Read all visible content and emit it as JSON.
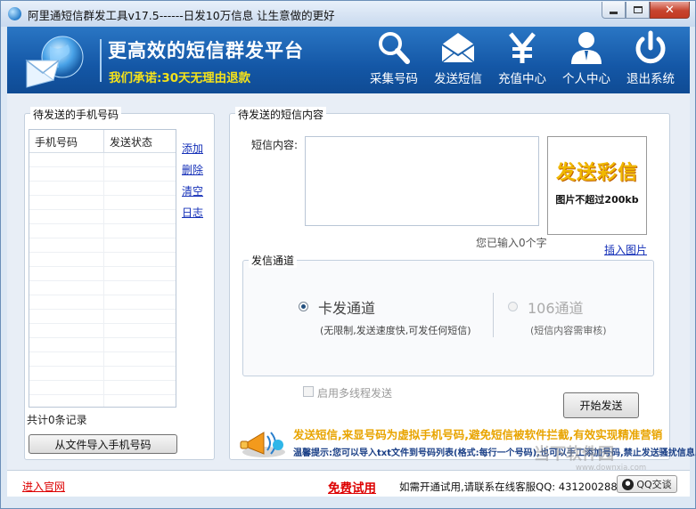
{
  "window": {
    "title": "阿里通短信群发工具v17.5------日发10万信息 让生意做的更好",
    "close_glyph": "✕"
  },
  "banner": {
    "slogan": "更高效的短信群发平台",
    "promise": "我们承诺:30天无理由退款",
    "nav": [
      {
        "label": "采集号码",
        "icon": "search-icon"
      },
      {
        "label": "发送短信",
        "icon": "envelope-icon"
      },
      {
        "label": "充值中心",
        "icon": "yen-icon"
      },
      {
        "label": "个人中心",
        "icon": "user-icon"
      },
      {
        "label": "退出系统",
        "icon": "power-icon"
      }
    ]
  },
  "left_panel": {
    "title": "待发送的手机号码",
    "columns": [
      "手机号码",
      "发送状态"
    ],
    "links": [
      "添加",
      "删除",
      "清空",
      "日志"
    ],
    "record_count": "共计0条记录",
    "import_button": "从文件导入手机号码"
  },
  "right_panel": {
    "title": "待发送的短信内容",
    "sms_label": "短信内容:",
    "sms_value": "",
    "char_count": "您已输入0个字",
    "mms_title": "发送彩信",
    "mms_sub": "图片不超过200kb",
    "insert_image": "插入图片",
    "channel": {
      "title": "发信通道",
      "option1": {
        "name": "卡发通道",
        "desc": "(无限制,发送速度快,可发任何短信)",
        "checked": true
      },
      "option2": {
        "name": "106通道",
        "desc": "(短信内容需审核)",
        "checked": false
      }
    },
    "multithread_label": "启用多线程发送",
    "send_button": "开始发送",
    "promo_headline": "发送短信,来显号码为虚拟手机号码,避免短信被软件拦截,有效实现精准营销",
    "promo_tip": "温馨提示:您可以导入txt文件到号码列表(格式:每行一个号码),也可以手工添加号码,禁止发送骚扰信息."
  },
  "statusbar": {
    "site_link": "进入官网",
    "trial": "免费试用",
    "contact": "如需开通试用,请联系在线客服QQ: 431200288",
    "qq_button": "QQ交谈"
  },
  "watermark": {
    "main": "当下软件园",
    "sub": "www.downxia.com"
  },
  "colors": {
    "banner": "#1457a6",
    "promise": "#f5e21a",
    "link": "#1530b8",
    "trial": "#dd0000"
  }
}
